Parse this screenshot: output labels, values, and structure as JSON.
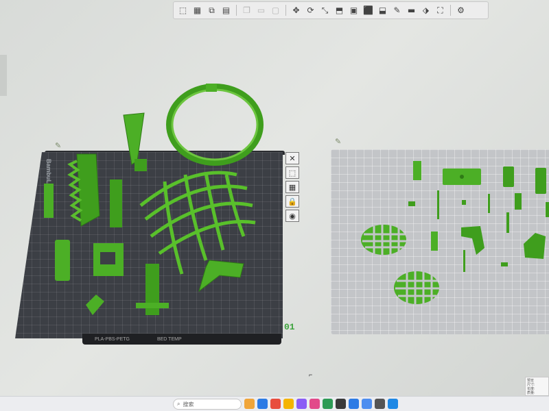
{
  "toolbar": {
    "buttons": [
      {
        "name": "add-object-icon",
        "glyph": "⬚",
        "dim": false
      },
      {
        "name": "grid-icon",
        "glyph": "▦",
        "dim": false
      },
      {
        "name": "plate-icon",
        "glyph": "⧉",
        "dim": false
      },
      {
        "name": "arrange-icon",
        "glyph": "▤",
        "dim": false
      },
      {
        "name": "copy-icon",
        "glyph": "❐",
        "dim": true
      },
      {
        "name": "paste-icon",
        "glyph": "▭",
        "dim": true
      },
      {
        "name": "delete-icon",
        "glyph": "▢",
        "dim": true
      },
      {
        "name": "move-icon",
        "glyph": "✥",
        "dim": false
      },
      {
        "name": "rotate-icon",
        "glyph": "⟳",
        "dim": false
      },
      {
        "name": "scale-icon",
        "glyph": "⤡",
        "dim": false
      },
      {
        "name": "lay-flat-icon",
        "glyph": "⬒",
        "dim": false
      },
      {
        "name": "cut-icon",
        "glyph": "▣",
        "dim": false
      },
      {
        "name": "support-paint-icon",
        "glyph": "⬛",
        "dim": false
      },
      {
        "name": "seam-icon",
        "glyph": "⬓",
        "dim": false
      },
      {
        "name": "color-paint-icon",
        "glyph": "✎",
        "dim": false
      },
      {
        "name": "measure-icon",
        "glyph": "▬",
        "dim": false
      },
      {
        "name": "assembly-icon",
        "glyph": "⬗",
        "dim": false
      },
      {
        "name": "explode-icon",
        "glyph": "⛶",
        "dim": false
      },
      {
        "name": "settings-icon",
        "glyph": "⚙",
        "dim": false
      }
    ]
  },
  "plate": {
    "bed_brand": "BambuLab",
    "number": "01",
    "filament_label": "PLA-PBS-PETG",
    "info_label": "BED TEMP",
    "edit_glyph": "✎"
  },
  "plate_tools": [
    {
      "name": "close-plate-icon",
      "glyph": "✕"
    },
    {
      "name": "orient-plate-icon",
      "glyph": "⬚"
    },
    {
      "name": "arrange-plate-icon",
      "glyph": "▦"
    },
    {
      "name": "lock-plate-icon",
      "glyph": "🔒"
    },
    {
      "name": "plate-settings-icon",
      "glyph": "◉"
    }
  ],
  "colors": {
    "part_green": "#4caf26",
    "part_green_dark": "#2f7a16",
    "bed_dark": "#3c3f45",
    "bed_light": "#c3c5c8"
  },
  "taskbar": {
    "search_placeholder": "搜索",
    "search_glyph": "⌕",
    "tray_lines": [
      "预览",
      "尺寸:",
      "长度:",
      "质量:"
    ],
    "app_colors": [
      "#f0a53a",
      "#2c7be5",
      "#e84d3d",
      "#f4b400",
      "#8b5cf6",
      "#e24a8a",
      "#2d9b55",
      "#3a3a3a",
      "#2c7be5",
      "#4d8ef0",
      "#555",
      "#1e88e5"
    ]
  }
}
